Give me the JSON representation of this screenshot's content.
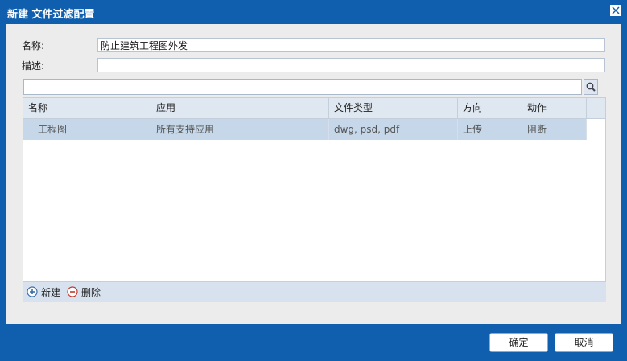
{
  "dialog": {
    "title": "新建 文件过滤配置"
  },
  "form": {
    "name_label": "名称:",
    "name_value": "防止建筑工程图外发",
    "desc_label": "描述:",
    "desc_value": ""
  },
  "search": {
    "value": ""
  },
  "grid": {
    "headers": [
      "名称",
      "应用",
      "文件类型",
      "方向",
      "动作"
    ],
    "rows": [
      [
        "工程图",
        "所有支持应用",
        "dwg, psd, pdf",
        "上传",
        "阻断"
      ]
    ]
  },
  "footer": {
    "add_label": "新建",
    "delete_label": "删除"
  },
  "buttons": {
    "ok_label": "确定",
    "cancel_label": "取消"
  },
  "colors": {
    "frame": "#0f5fae",
    "selected_row": "#c5d7e8",
    "header_bg": "#dfe7f1"
  }
}
